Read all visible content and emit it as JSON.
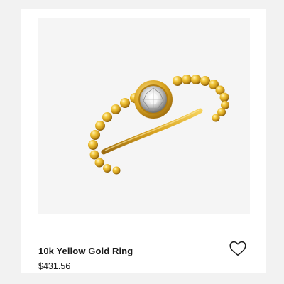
{
  "product": {
    "name": "10k Yellow Gold Ring",
    "price": "$431.56",
    "image_icon": "gold-ring-with-round-diamond-solitaire-icon",
    "favorite_icon": "heart-outline-icon"
  },
  "colors": {
    "page_background": "#f2f2f2",
    "card_background": "#ffffff",
    "image_background": "#f5f5f5",
    "gold": "#e6b62a",
    "text": "#1a1a1a"
  }
}
